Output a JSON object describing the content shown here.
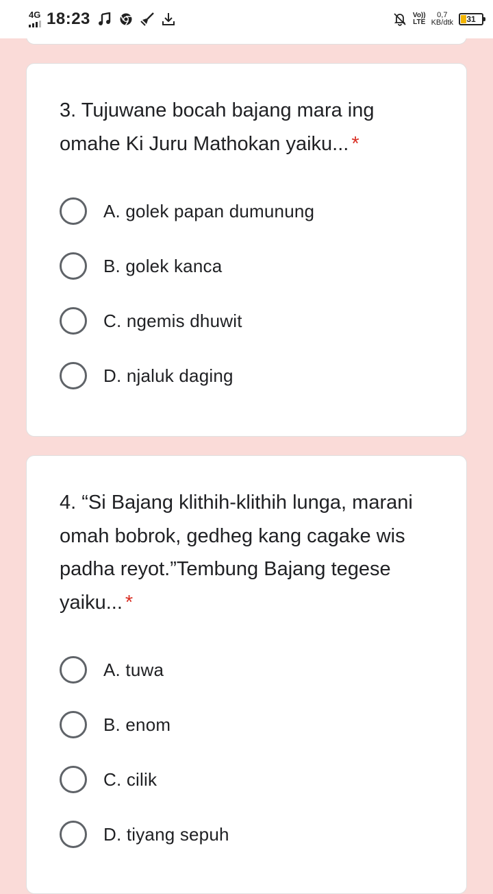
{
  "status_bar": {
    "network": "4G",
    "time": "18:23",
    "volte": [
      "Vo))",
      "LTE"
    ],
    "net_speed": [
      "0,7",
      "KB/dtk"
    ],
    "battery_level": "31",
    "battery_fraction": 0.31,
    "icons": [
      "music-note-icon",
      "chrome-icon",
      "cleaner-broom-icon",
      "download-icon",
      "bell-off-icon"
    ]
  },
  "questions": [
    {
      "text": "3. Tujuwane bocah bajang mara ing omahe Ki Juru Mathokan yaiku...",
      "required_mark": "*",
      "options": [
        "A. golek papan dumunung",
        "B. golek kanca",
        "C. ngemis dhuwit",
        "D. njaluk daging"
      ]
    },
    {
      "text": "4. “Si Bajang klithih-klithih lunga, marani omah bobrok, gedheg kang cagake wis padha reyot.”Tembung Bajang tegese yaiku...",
      "required_mark": "*",
      "options": [
        "A. tuwa",
        "B. enom",
        "C. cilik",
        "D. tiyang sepuh"
      ]
    }
  ],
  "colors": {
    "page_background": "#fadbd8",
    "card_background": "#ffffff",
    "required": "#d93025",
    "radio_border": "#5f6368",
    "battery": "#f2b400"
  }
}
